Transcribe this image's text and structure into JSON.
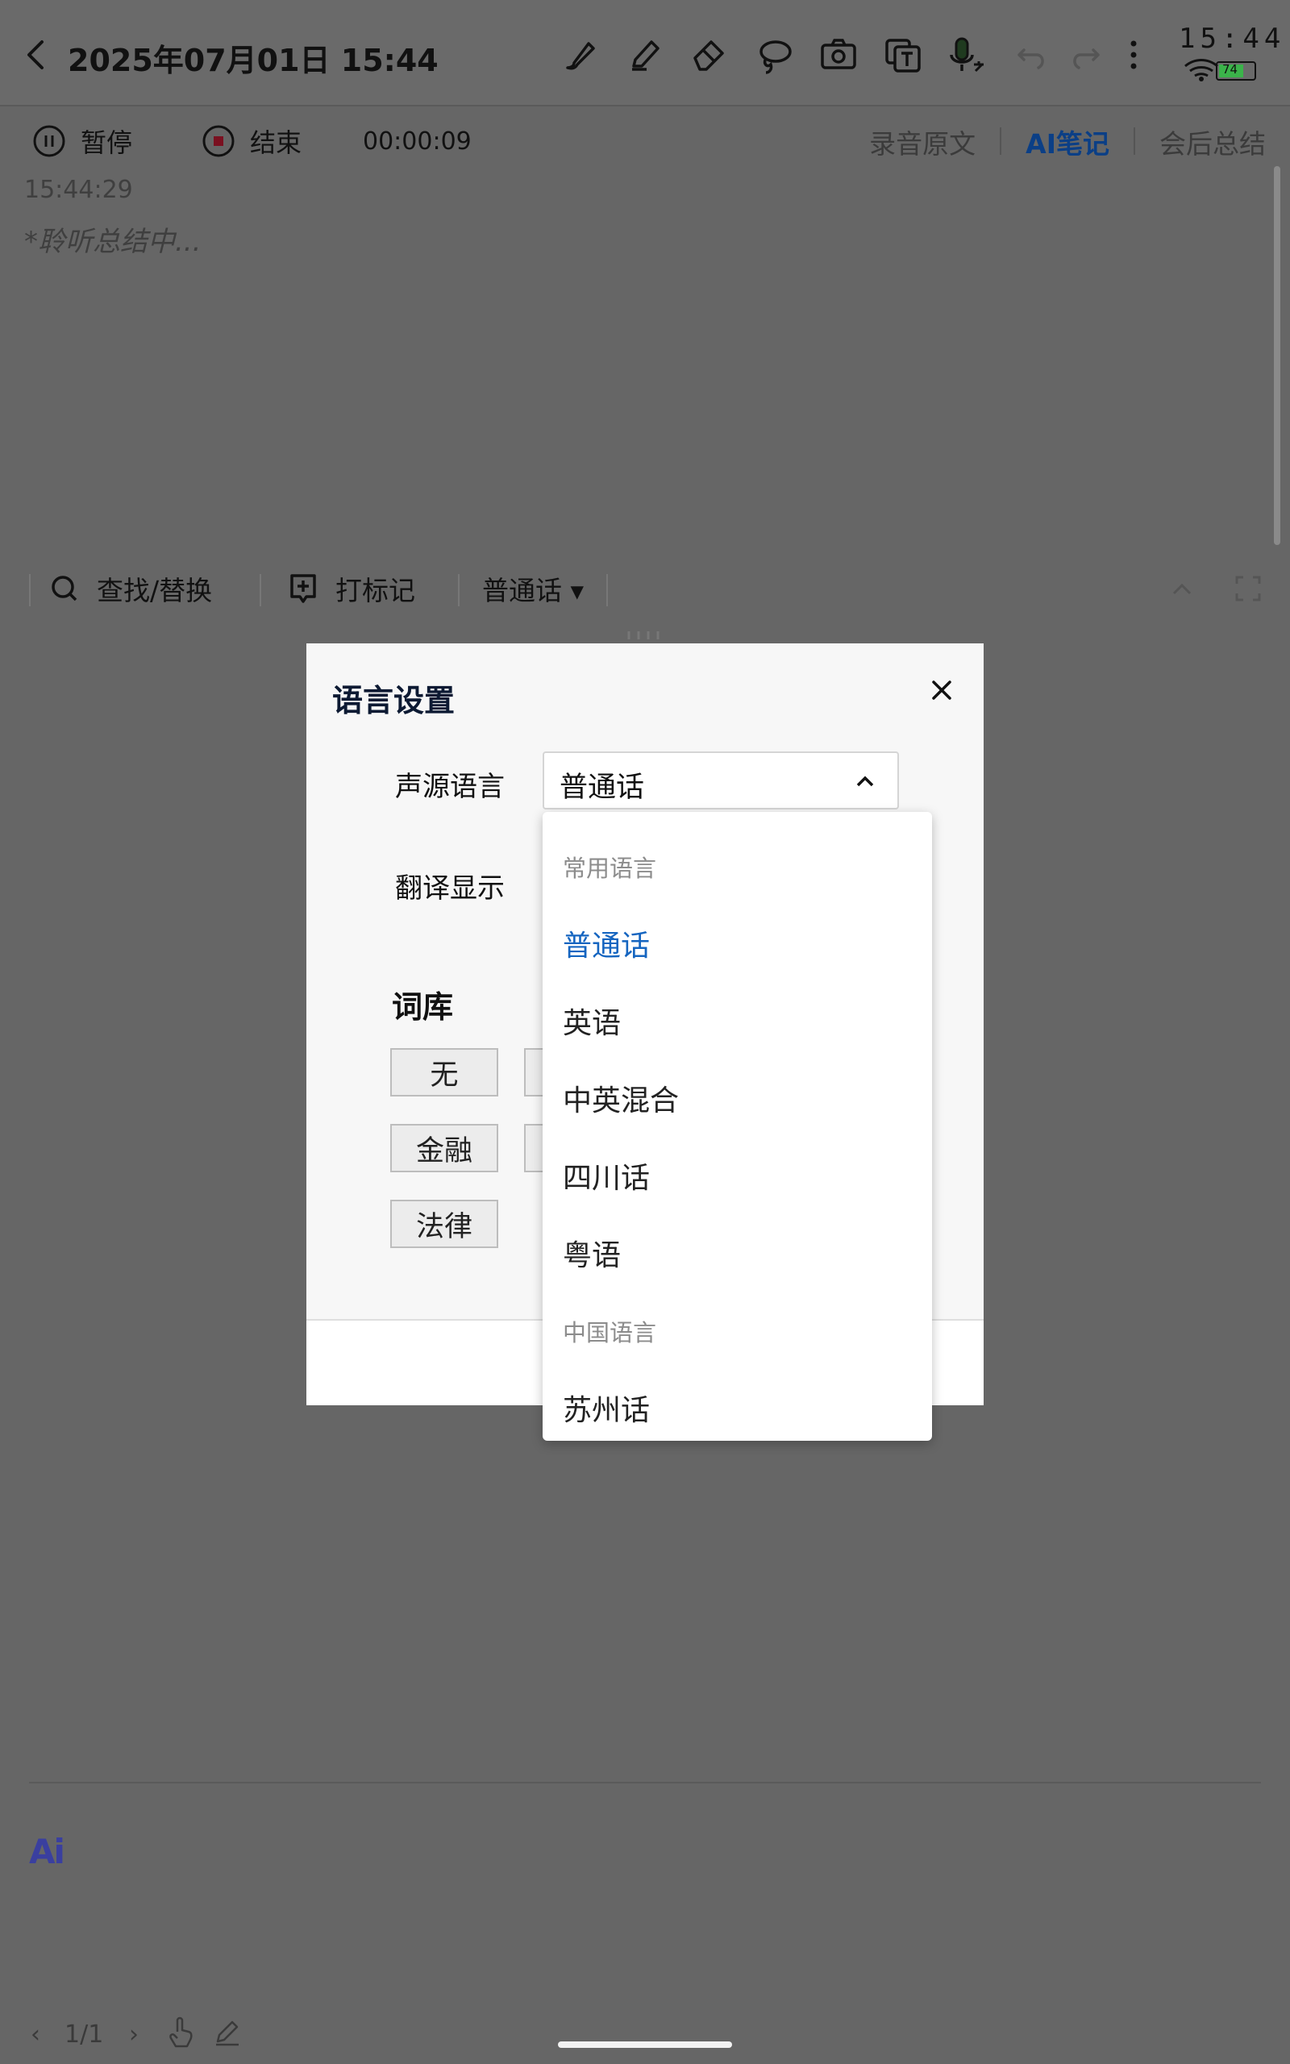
{
  "header": {
    "title": "2025年07月01日 15:44",
    "status_time": "15:44",
    "battery": "74"
  },
  "recording": {
    "pause_label": "暂停",
    "stop_label": "结束",
    "timer": "00:00:09"
  },
  "tabs": [
    {
      "label": "录音原文",
      "active": false
    },
    {
      "label": "AI笔记",
      "active": true
    },
    {
      "label": "会后总结",
      "active": false
    }
  ],
  "transcript": {
    "timestamp": "15:44:29",
    "status_text": "*聆听总结中..."
  },
  "toolbar": {
    "find_replace": "查找/替换",
    "mark": "打标记",
    "language": "普通话 ▾"
  },
  "dialog": {
    "title": "语言设置",
    "source_language_label": "声源语言",
    "source_language_value": "普通话",
    "translation_label": "翻译显示",
    "lexicon_title": "词库",
    "lexicon_chips": [
      "无",
      "金融",
      "法律"
    ]
  },
  "dropdown": {
    "groups": [
      {
        "label": "常用语言",
        "options": [
          "普通话",
          "英语",
          "中英混合",
          "四川话",
          "粤语"
        ]
      },
      {
        "label": "中国语言",
        "options": [
          "苏州话"
        ]
      }
    ],
    "selected": "普通话"
  },
  "footer": {
    "ai_logo": "Ai",
    "page_indicator": "1/1",
    "prev": "‹",
    "next": "›"
  },
  "colors": {
    "accent": "#1565c0",
    "active_tab": "#0b3f86",
    "overlay": "#666666"
  }
}
